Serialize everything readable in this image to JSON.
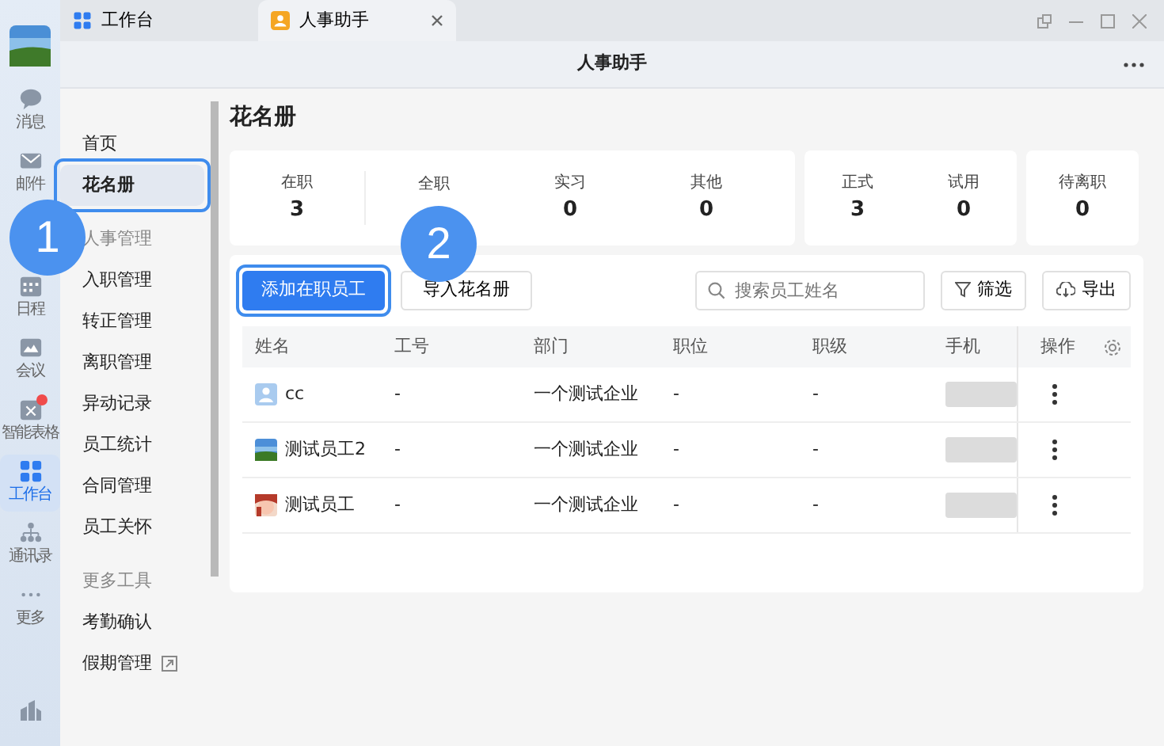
{
  "rail": {
    "items": [
      {
        "label": "消息",
        "selected": false,
        "badge": false
      },
      {
        "label": "邮件",
        "selected": false,
        "badge": false
      },
      {
        "label": "日程",
        "selected": false,
        "badge": false
      },
      {
        "label": "会议",
        "selected": false,
        "badge": false
      },
      {
        "label": "智能表格",
        "selected": false,
        "badge": true
      },
      {
        "label": "工作台",
        "selected": true,
        "badge": false
      },
      {
        "label": "通讯录",
        "selected": false,
        "badge": false
      },
      {
        "label": "更多",
        "selected": false,
        "badge": false
      }
    ]
  },
  "tabs": [
    {
      "label": "工作台",
      "selected": false,
      "closable": false
    },
    {
      "label": "人事助手",
      "selected": true,
      "closable": true
    }
  ],
  "header": {
    "title": "人事助手"
  },
  "nav": [
    {
      "kind": "item",
      "label": "首页",
      "selected": false,
      "highlighted": false
    },
    {
      "kind": "item",
      "label": "花名册",
      "selected": true,
      "highlighted": true
    },
    {
      "kind": "section",
      "label": "人事管理"
    },
    {
      "kind": "item",
      "label": "入职管理",
      "selected": false,
      "highlighted": false
    },
    {
      "kind": "item",
      "label": "转正管理",
      "selected": false,
      "highlighted": false
    },
    {
      "kind": "item",
      "label": "离职管理",
      "selected": false,
      "highlighted": false
    },
    {
      "kind": "item",
      "label": "异动记录",
      "selected": false,
      "highlighted": false
    },
    {
      "kind": "item",
      "label": "员工统计",
      "selected": false,
      "highlighted": false
    },
    {
      "kind": "item",
      "label": "合同管理",
      "selected": false,
      "highlighted": false
    },
    {
      "kind": "item",
      "label": "员工关怀",
      "selected": false,
      "highlighted": false
    },
    {
      "kind": "section",
      "label": "更多工具"
    },
    {
      "kind": "item",
      "label": "考勤确认",
      "selected": false,
      "highlighted": false
    },
    {
      "kind": "external",
      "label": "假期管理",
      "selected": false,
      "highlighted": false
    }
  ],
  "page_title": "花名册",
  "stat_groups": [
    [
      {
        "label": "在职",
        "value": "3"
      },
      {
        "label": "全职"
      },
      {
        "label": "实习",
        "value": "0"
      },
      {
        "label": "其他",
        "value": "0"
      }
    ],
    [
      {
        "label": "正式",
        "value": "3"
      },
      {
        "label": "试用",
        "value": "0"
      }
    ],
    [
      {
        "label": "待离职",
        "value": "0"
      }
    ]
  ],
  "toolbar": {
    "primary": {
      "label": "添加在职员工",
      "highlighted": true
    },
    "import": "导入花名册",
    "search": {
      "placeholder": "搜索员工姓名"
    },
    "filter": "筛选",
    "export": "导出"
  },
  "table": {
    "columns": [
      "姓名",
      "工号",
      "部门",
      "职位",
      "职级",
      "手机",
      "操作"
    ],
    "rows": [
      {
        "kind": "icon",
        "name": "cc",
        "number": "-",
        "department": "一个测试企业",
        "position": "-",
        "grade": "-"
      },
      {
        "kind": "picture",
        "name": "测试员工2",
        "number": "-",
        "department": "一个测试企业",
        "position": "-",
        "grade": "-"
      },
      {
        "kind": "picture",
        "name": "测试员工",
        "number": "-",
        "department": "一个测试企业",
        "position": "-",
        "grade": "-"
      }
    ]
  },
  "callouts": [
    {
      "number": "1"
    },
    {
      "number": "2"
    }
  ]
}
